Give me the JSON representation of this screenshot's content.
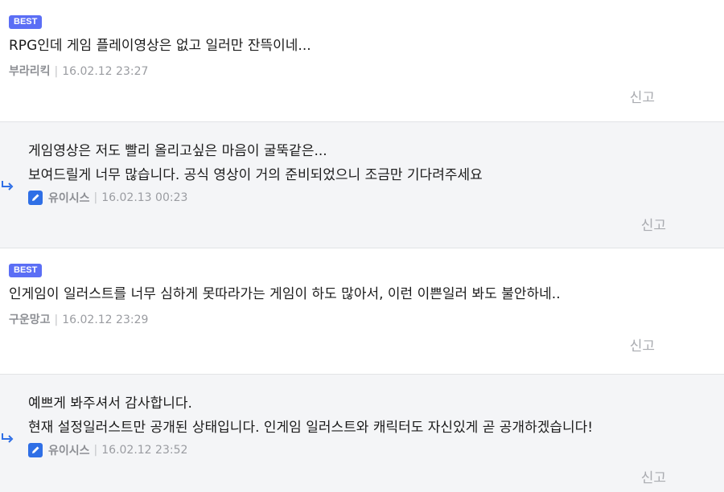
{
  "comments": [
    {
      "badge": "BEST",
      "text": "RPG인데 게임 플레이영상은 없고 일러만 잔뜩이네...",
      "author": "부라리킥",
      "date": "16.02.12 23:27",
      "report": "신고"
    },
    {
      "lines": [
        "게임영상은 저도 빨리 올리고싶은 마음이 굴뚝같은...",
        "보여드릴게 너무 많습니다. 공식 영상이 거의 준비되었으니 조금만 기다려주세요"
      ],
      "author": "유이시스",
      "date": "16.02.13 00:23",
      "report": "신고"
    },
    {
      "badge": "BEST",
      "text": "인게임이 일러스트를 너무 심하게 못따라가는 게임이 하도 많아서, 이런 이쁜일러 봐도 불안하네..",
      "author": "구운망고",
      "date": "16.02.12 23:29",
      "report": "신고"
    },
    {
      "lines": [
        "예쁘게 봐주셔서 감사합니다.",
        "현재 설정일러스트만 공개된 상태입니다. 인게임 일러스트와 캐릭터도 자신있게 곧 공개하겠습니다!"
      ],
      "author": "유이시스",
      "date": "16.02.12 23:52",
      "report": "신고"
    }
  ],
  "meta_separator": "|",
  "colors": {
    "badge": "#5b6ef5",
    "reply_bg": "#f4f5f7",
    "writer_icon": "#2f6fe6",
    "reply_arrow": "#2f6fe6"
  },
  "icons": {
    "reply": "reply-arrow-icon",
    "writer": "pencil-icon"
  }
}
